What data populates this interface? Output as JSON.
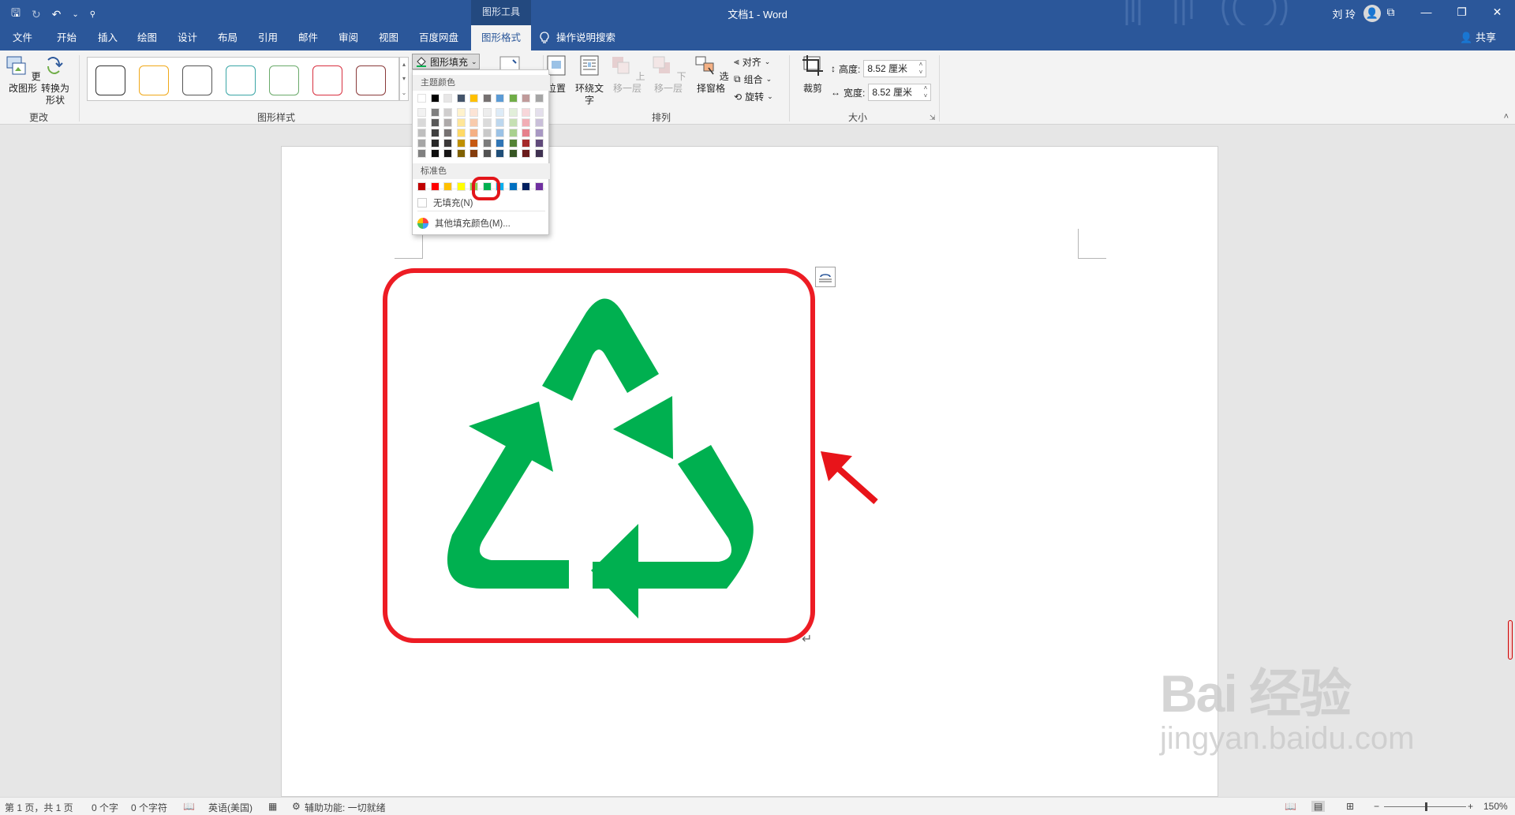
{
  "titlebar": {
    "context_label": "图形工具",
    "doc_title": "文档1  -  Word",
    "user_name": "刘 玲",
    "user_initial": "👤",
    "qat": {
      "save": "🖫",
      "redo": "↻",
      "undo": "↶",
      "undo_more": "⌄",
      "customize": "⚲"
    },
    "win": {
      "ribbon_display": "⧉",
      "minimize": "—",
      "restore": "❐",
      "close": "✕"
    }
  },
  "tabs": [
    "文件",
    "开始",
    "插入",
    "绘图",
    "设计",
    "布局",
    "引用",
    "邮件",
    "审阅",
    "视图",
    "百度网盘",
    "图形格式"
  ],
  "tell_me": "操作说明搜索",
  "share": "共享",
  "ribbon": {
    "change_group": {
      "change_shape": "更改图形",
      "convert": "转换为形状",
      "label": "更改"
    },
    "style_group": {
      "label": "图形样式",
      "swatch_colors": [
        "#222222",
        "#f0a818",
        "#555555",
        "#3aa6a6",
        "#6aaa6a",
        "#d83040",
        "#8a3a3a"
      ],
      "fill_button": "图形填充",
      "fill_arrow": "⌄"
    },
    "arrange_group": {
      "position": "位置",
      "wrap_text": "环绕文字",
      "bring_forward": "上移一层",
      "send_backward": "下移一层",
      "selection_pane": "选择窗格",
      "align": "对齐",
      "group": "组合",
      "rotate": "旋转",
      "label": "排列"
    },
    "size_group": {
      "crop": "裁剪",
      "height_label": "高度:",
      "height_value": "8.52 厘米",
      "width_label": "宽度:",
      "width_value": "8.52 厘米",
      "label": "大小"
    }
  },
  "dropdown": {
    "theme_header": "主题颜色",
    "theme_top": [
      "#ffffff",
      "#000000",
      "#e7e6e6",
      "#44546a",
      "#ffc000",
      "#767171",
      "#5b9bd5",
      "#70ad47",
      "#c09a9a",
      "#a5a5a5"
    ],
    "theme_columns": [
      [
        "#f2f2f2",
        "#d9d9d9",
        "#bfbfbf",
        "#a6a6a6",
        "#808080"
      ],
      [
        "#7f7f7f",
        "#595959",
        "#404040",
        "#262626",
        "#0d0d0d"
      ],
      [
        "#d0cece",
        "#aeaaaa",
        "#767171",
        "#3a3838",
        "#171616"
      ],
      [
        "#fff2cc",
        "#ffe699",
        "#ffd966",
        "#bf9000",
        "#7f6000"
      ],
      [
        "#fce4d6",
        "#f8cbad",
        "#f4b084",
        "#c65911",
        "#843c0c"
      ],
      [
        "#ededed",
        "#dbdbdb",
        "#c9c9c9",
        "#7b7b7b",
        "#525252"
      ],
      [
        "#ddebf7",
        "#bdd7ee",
        "#9bc2e6",
        "#2f75b5",
        "#1f4e78"
      ],
      [
        "#e2efda",
        "#c6e0b4",
        "#a9d08e",
        "#548235",
        "#375623"
      ],
      [
        "#f8d7da",
        "#f1aeb5",
        "#e6808b",
        "#a52a2a",
        "#6a1b1b"
      ],
      [
        "#e4dfec",
        "#c9bfd9",
        "#a898c3",
        "#604a7b",
        "#3f3151"
      ]
    ],
    "standard_header": "标准色",
    "standard": [
      "#c00000",
      "#ff0000",
      "#ffc000",
      "#ffff00",
      "#92d050",
      "#00b050",
      "#00b0f0",
      "#0070c0",
      "#002060",
      "#7030a0"
    ],
    "no_fill": "无填充(N)",
    "more_colors": "其他填充颜色(M)..."
  },
  "document": {
    "shape_fill": "#ffffff",
    "shape_border": "#ed1c24",
    "symbol_color": "#00b050",
    "arrow_color": "#e8141a"
  },
  "status": {
    "page": "第 1 页，共 1 页",
    "words": "0 个字",
    "chars": "0 个字符",
    "language": "英语(美国)",
    "accessibility": "辅助功能: 一切就绪",
    "zoom": "150%",
    "zoom_minus": "−",
    "zoom_plus": "+"
  },
  "watermark": {
    "main": "Bai 经验",
    "sub": "jingyan.baidu.com"
  }
}
